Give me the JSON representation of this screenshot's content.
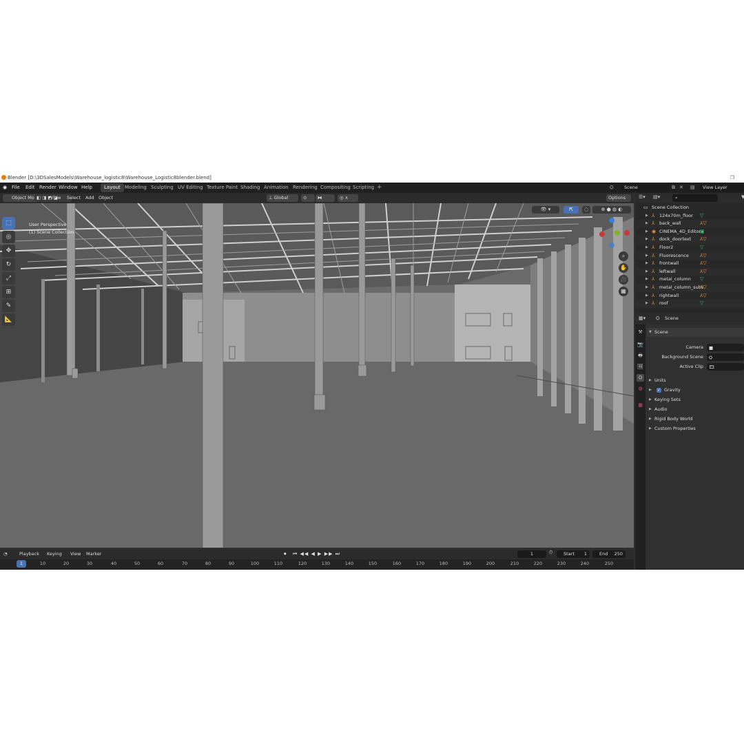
{
  "title_bar": {
    "text": "Blender [D:\\3DSalesModels\\Warehouse_logistic8\\Warehouse_Logistic8blender.blend]"
  },
  "menu": [
    "File",
    "Edit",
    "Render",
    "Window",
    "Help"
  ],
  "workspaces": [
    "Layout",
    "Modeling",
    "Sculpting",
    "UV Editing",
    "Texture Paint",
    "Shading",
    "Animation",
    "Rendering",
    "Compositing",
    "Scripting"
  ],
  "active_workspace": "Layout",
  "scene_field": "Scene",
  "view_layer_field": "View Layer",
  "viewport_header": {
    "mode": "Object Mode",
    "menus": [
      "View",
      "Select",
      "Add",
      "Object"
    ],
    "transform_orientation": "Global",
    "options_label": "Options"
  },
  "viewport": {
    "view_name": "User Perspective",
    "collection_label": "(1) Scene Collection"
  },
  "tools": [
    "select-box",
    "cursor",
    "move",
    "rotate",
    "scale",
    "transform",
    "annotate",
    "measure"
  ],
  "outliner": {
    "root": "Scene Collection",
    "items": [
      {
        "name": "124x70m_floor",
        "type": "mesh"
      },
      {
        "name": "back_wall",
        "type": "armature"
      },
      {
        "name": "CINEMA_4D_Editor",
        "type": "camera"
      },
      {
        "name": "dock_doortext",
        "type": "armature"
      },
      {
        "name": "Floor2",
        "type": "mesh"
      },
      {
        "name": "Fluorescence",
        "type": "armature"
      },
      {
        "name": "frontwall",
        "type": "armature"
      },
      {
        "name": "leftwall",
        "type": "armature"
      },
      {
        "name": "metal_column",
        "type": "mesh"
      },
      {
        "name": "metal_column_subs",
        "type": "armature"
      },
      {
        "name": "rightwall",
        "type": "armature"
      },
      {
        "name": "roof",
        "type": "mesh"
      }
    ]
  },
  "properties": {
    "context": "Scene",
    "section": "Scene",
    "fields": [
      {
        "label": "Camera"
      },
      {
        "label": "Background Scene"
      },
      {
        "label": "Active Clip"
      }
    ],
    "panels": [
      {
        "label": "Units",
        "checkbox": false
      },
      {
        "label": "Gravity",
        "checkbox": true
      },
      {
        "label": "Keying Sets",
        "checkbox": false
      },
      {
        "label": "Audio",
        "checkbox": false
      },
      {
        "label": "Rigid Body World",
        "checkbox": false
      },
      {
        "label": "Custom Properties",
        "checkbox": false
      }
    ]
  },
  "timeline": {
    "menus": [
      "Playback",
      "Keying",
      "View",
      "Marker"
    ],
    "current_frame": "1",
    "start_label": "Start",
    "start_value": "1",
    "end_label": "End",
    "end_value": "250",
    "ruler_ticks": [
      "1",
      "10",
      "20",
      "30",
      "40",
      "50",
      "60",
      "70",
      "80",
      "90",
      "100",
      "110",
      "120",
      "130",
      "140",
      "150",
      "160",
      "170",
      "180",
      "190",
      "200",
      "210",
      "220",
      "230",
      "240",
      "250"
    ]
  },
  "colors": {
    "accent_blue": "#4772b3",
    "mesh_icon": "#3fbf6f",
    "object_icon": "#e89a3c",
    "viewport_bg": "#6b6b6b"
  }
}
